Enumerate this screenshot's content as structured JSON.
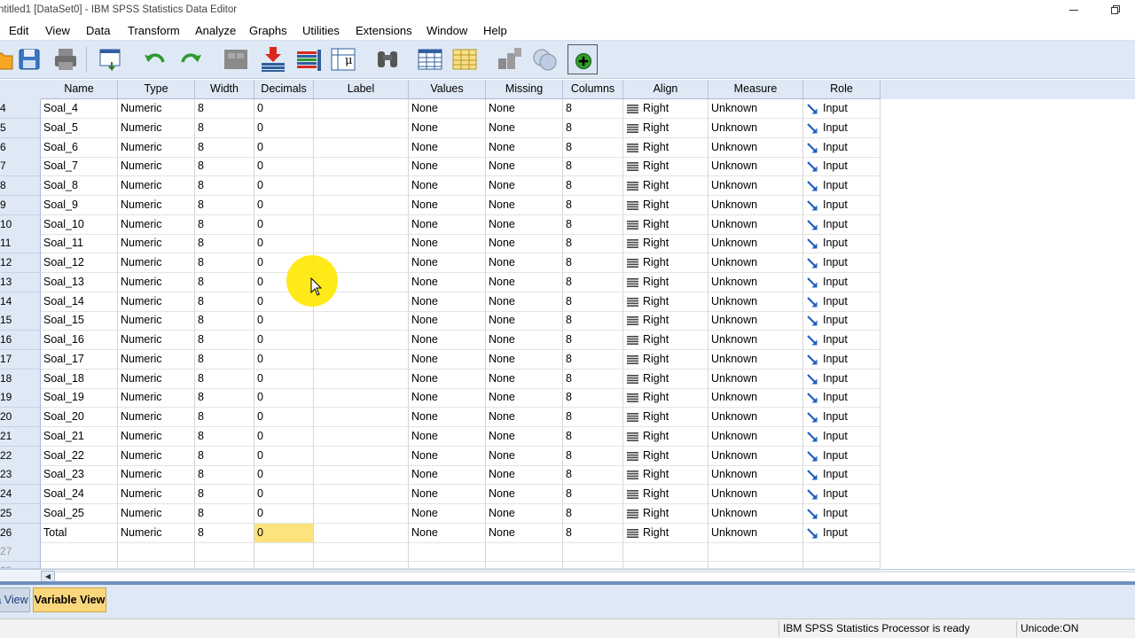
{
  "window": {
    "title": "ntitled1 [DataSet0] - IBM SPSS Statistics Data Editor"
  },
  "menu": [
    "Edit",
    "View",
    "Data",
    "Transform",
    "Analyze",
    "Graphs",
    "Utilities",
    "Extensions",
    "Window",
    "Help"
  ],
  "toolbar": {
    "icons": [
      "open-icon",
      "save-icon",
      "print-icon",
      "recall-dialog-icon",
      "undo-icon",
      "redo-icon",
      "goto-case-icon",
      "goto-variable-icon",
      "insert-cases-icon",
      "insert-variable-icon",
      "variables-icon",
      "find-icon",
      "split-file-icon",
      "weight-cases-icon",
      "select-cases-icon",
      "value-labels-icon",
      "use-sets-icon"
    ]
  },
  "columns": [
    "Name",
    "Type",
    "Width",
    "Decimals",
    "Label",
    "Values",
    "Missing",
    "Columns",
    "Align",
    "Measure",
    "Role"
  ],
  "rows": [
    {
      "num": "4",
      "name": "Soal_4",
      "type": "Numeric",
      "width": "8",
      "decimals": "0",
      "label": "",
      "values": "None",
      "missing": "None",
      "columns": "8",
      "align": "Right",
      "measure": "Unknown",
      "role": "Input"
    },
    {
      "num": "5",
      "name": "Soal_5",
      "type": "Numeric",
      "width": "8",
      "decimals": "0",
      "label": "",
      "values": "None",
      "missing": "None",
      "columns": "8",
      "align": "Right",
      "measure": "Unknown",
      "role": "Input"
    },
    {
      "num": "6",
      "name": "Soal_6",
      "type": "Numeric",
      "width": "8",
      "decimals": "0",
      "label": "",
      "values": "None",
      "missing": "None",
      "columns": "8",
      "align": "Right",
      "measure": "Unknown",
      "role": "Input"
    },
    {
      "num": "7",
      "name": "Soal_7",
      "type": "Numeric",
      "width": "8",
      "decimals": "0",
      "label": "",
      "values": "None",
      "missing": "None",
      "columns": "8",
      "align": "Right",
      "measure": "Unknown",
      "role": "Input"
    },
    {
      "num": "8",
      "name": "Soal_8",
      "type": "Numeric",
      "width": "8",
      "decimals": "0",
      "label": "",
      "values": "None",
      "missing": "None",
      "columns": "8",
      "align": "Right",
      "measure": "Unknown",
      "role": "Input"
    },
    {
      "num": "9",
      "name": "Soal_9",
      "type": "Numeric",
      "width": "8",
      "decimals": "0",
      "label": "",
      "values": "None",
      "missing": "None",
      "columns": "8",
      "align": "Right",
      "measure": "Unknown",
      "role": "Input"
    },
    {
      "num": "10",
      "name": "Soal_10",
      "type": "Numeric",
      "width": "8",
      "decimals": "0",
      "label": "",
      "values": "None",
      "missing": "None",
      "columns": "8",
      "align": "Right",
      "measure": "Unknown",
      "role": "Input"
    },
    {
      "num": "11",
      "name": "Soal_11",
      "type": "Numeric",
      "width": "8",
      "decimals": "0",
      "label": "",
      "values": "None",
      "missing": "None",
      "columns": "8",
      "align": "Right",
      "measure": "Unknown",
      "role": "Input"
    },
    {
      "num": "12",
      "name": "Soal_12",
      "type": "Numeric",
      "width": "8",
      "decimals": "0",
      "label": "",
      "values": "None",
      "missing": "None",
      "columns": "8",
      "align": "Right",
      "measure": "Unknown",
      "role": "Input"
    },
    {
      "num": "13",
      "name": "Soal_13",
      "type": "Numeric",
      "width": "8",
      "decimals": "0",
      "label": "",
      "values": "None",
      "missing": "None",
      "columns": "8",
      "align": "Right",
      "measure": "Unknown",
      "role": "Input"
    },
    {
      "num": "14",
      "name": "Soal_14",
      "type": "Numeric",
      "width": "8",
      "decimals": "0",
      "label": "",
      "values": "None",
      "missing": "None",
      "columns": "8",
      "align": "Right",
      "measure": "Unknown",
      "role": "Input"
    },
    {
      "num": "15",
      "name": "Soal_15",
      "type": "Numeric",
      "width": "8",
      "decimals": "0",
      "label": "",
      "values": "None",
      "missing": "None",
      "columns": "8",
      "align": "Right",
      "measure": "Unknown",
      "role": "Input"
    },
    {
      "num": "16",
      "name": "Soal_16",
      "type": "Numeric",
      "width": "8",
      "decimals": "0",
      "label": "",
      "values": "None",
      "missing": "None",
      "columns": "8",
      "align": "Right",
      "measure": "Unknown",
      "role": "Input"
    },
    {
      "num": "17",
      "name": "Soal_17",
      "type": "Numeric",
      "width": "8",
      "decimals": "0",
      "label": "",
      "values": "None",
      "missing": "None",
      "columns": "8",
      "align": "Right",
      "measure": "Unknown",
      "role": "Input"
    },
    {
      "num": "18",
      "name": "Soal_18",
      "type": "Numeric",
      "width": "8",
      "decimals": "0",
      "label": "",
      "values": "None",
      "missing": "None",
      "columns": "8",
      "align": "Right",
      "measure": "Unknown",
      "role": "Input"
    },
    {
      "num": "19",
      "name": "Soal_19",
      "type": "Numeric",
      "width": "8",
      "decimals": "0",
      "label": "",
      "values": "None",
      "missing": "None",
      "columns": "8",
      "align": "Right",
      "measure": "Unknown",
      "role": "Input"
    },
    {
      "num": "20",
      "name": "Soal_20",
      "type": "Numeric",
      "width": "8",
      "decimals": "0",
      "label": "",
      "values": "None",
      "missing": "None",
      "columns": "8",
      "align": "Right",
      "measure": "Unknown",
      "role": "Input"
    },
    {
      "num": "21",
      "name": "Soal_21",
      "type": "Numeric",
      "width": "8",
      "decimals": "0",
      "label": "",
      "values": "None",
      "missing": "None",
      "columns": "8",
      "align": "Right",
      "measure": "Unknown",
      "role": "Input"
    },
    {
      "num": "22",
      "name": "Soal_22",
      "type": "Numeric",
      "width": "8",
      "decimals": "0",
      "label": "",
      "values": "None",
      "missing": "None",
      "columns": "8",
      "align": "Right",
      "measure": "Unknown",
      "role": "Input"
    },
    {
      "num": "23",
      "name": "Soal_23",
      "type": "Numeric",
      "width": "8",
      "decimals": "0",
      "label": "",
      "values": "None",
      "missing": "None",
      "columns": "8",
      "align": "Right",
      "measure": "Unknown",
      "role": "Input"
    },
    {
      "num": "24",
      "name": "Soal_24",
      "type": "Numeric",
      "width": "8",
      "decimals": "0",
      "label": "",
      "values": "None",
      "missing": "None",
      "columns": "8",
      "align": "Right",
      "measure": "Unknown",
      "role": "Input"
    },
    {
      "num": "25",
      "name": "Soal_25",
      "type": "Numeric",
      "width": "8",
      "decimals": "0",
      "label": "",
      "values": "None",
      "missing": "None",
      "columns": "8",
      "align": "Right",
      "measure": "Unknown",
      "role": "Input"
    },
    {
      "num": "26",
      "name": "Total",
      "type": "Numeric",
      "width": "8",
      "decimals": "0",
      "label": "",
      "values": "None",
      "missing": "None",
      "columns": "8",
      "align": "Right",
      "measure": "Unknown",
      "role": "Input",
      "selected_cell": "decimals"
    }
  ],
  "empty_rows": [
    "27",
    "28"
  ],
  "tabs": {
    "data_view": "a View",
    "variable_view": "Variable View",
    "active": "variable_view"
  },
  "status": {
    "processor": "IBM SPSS Statistics Processor is ready",
    "unicode": "Unicode:ON"
  },
  "colors": {
    "header_bg": "#dfe9f5",
    "selected_cell": "#fde37c",
    "active_tab": "#fbd77c",
    "role_arrow": "#1f5fbf"
  }
}
